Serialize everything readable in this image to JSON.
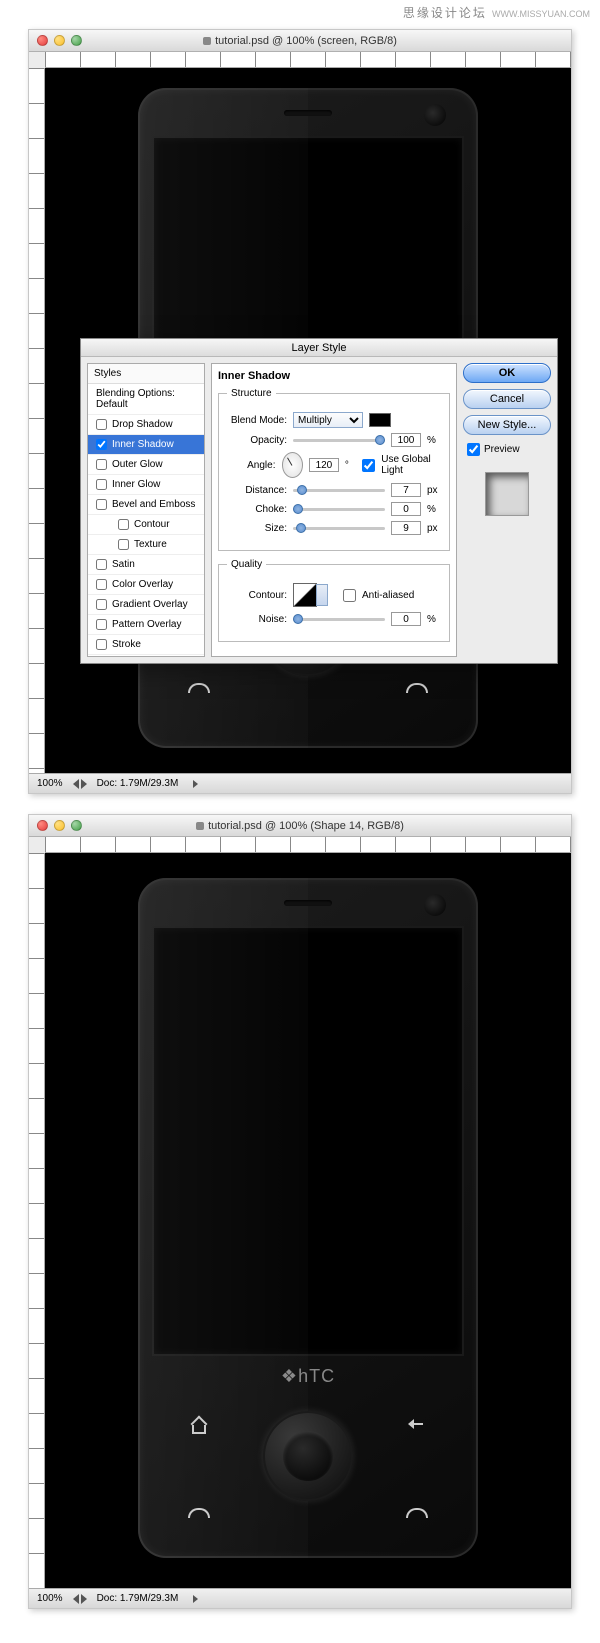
{
  "watermark": {
    "cn": "思缘设计论坛",
    "en": "WWW.MISSYUAN.COM"
  },
  "windowA": {
    "title": "tutorial.psd @ 100% (screen, RGB/8)",
    "zoom": "100%",
    "doc": "Doc: 1.79M/29.3M"
  },
  "windowB": {
    "title": "tutorial.psd @ 100% (Shape 14, RGB/8)",
    "zoom": "100%",
    "doc": "Doc: 1.79M/29.3M",
    "logo": "hTC"
  },
  "dialog": {
    "title": "Layer Style",
    "stylesHeader": "Styles",
    "blendingOptions": "Blending Options: Default",
    "effects": {
      "dropShadow": "Drop Shadow",
      "innerShadow": "Inner Shadow",
      "outerGlow": "Outer Glow",
      "innerGlow": "Inner Glow",
      "bevelEmboss": "Bevel and Emboss",
      "contour": "Contour",
      "texture": "Texture",
      "satin": "Satin",
      "colorOverlay": "Color Overlay",
      "gradientOverlay": "Gradient Overlay",
      "patternOverlay": "Pattern Overlay",
      "stroke": "Stroke"
    },
    "panelTitle": "Inner Shadow",
    "structure": {
      "legend": "Structure",
      "blendModeLabel": "Blend Mode:",
      "blendMode": "Multiply",
      "opacityLabel": "Opacity:",
      "opacity": "100",
      "opacityUnit": "%",
      "angleLabel": "Angle:",
      "angle": "120",
      "angleUnit": "°",
      "useGlobalLight": "Use Global Light",
      "distanceLabel": "Distance:",
      "distance": "7",
      "distanceUnit": "px",
      "chokeLabel": "Choke:",
      "choke": "0",
      "chokeUnit": "%",
      "sizeLabel": "Size:",
      "size": "9",
      "sizeUnit": "px"
    },
    "quality": {
      "legend": "Quality",
      "contourLabel": "Contour:",
      "antiAliased": "Anti-aliased",
      "noiseLabel": "Noise:",
      "noise": "0",
      "noiseUnit": "%"
    },
    "buttons": {
      "ok": "OK",
      "cancel": "Cancel",
      "newStyle": "New Style...",
      "preview": "Preview"
    }
  }
}
